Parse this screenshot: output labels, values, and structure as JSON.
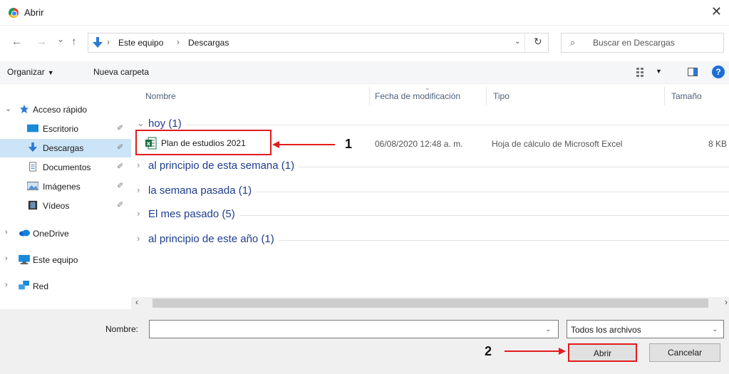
{
  "window": {
    "title": "Abrir",
    "close_glyph": "✕"
  },
  "nav_buttons": {
    "back": "←",
    "forward": "→",
    "recent": "⌄",
    "up": "↑"
  },
  "address": {
    "crumbs": [
      "Este equipo",
      "Descargas"
    ],
    "separator": "›",
    "dropdown": "⌄",
    "refresh": "↻"
  },
  "search": {
    "placeholder": "Buscar en Descargas",
    "icon": "search-icon"
  },
  "toolbar": {
    "organize": "Organizar",
    "new_folder": "Nueva carpeta",
    "help": "?"
  },
  "sidebar": {
    "items": [
      {
        "label": "Acceso rápido",
        "icon": "star-icon",
        "expander": "⌄"
      },
      {
        "label": "Escritorio",
        "icon": "desktop-icon",
        "pin": "📌"
      },
      {
        "label": "Descargas",
        "icon": "download-icon",
        "pin": "📌",
        "selected": true
      },
      {
        "label": "Documentos",
        "icon": "documents-icon",
        "pin": "📌"
      },
      {
        "label": "Imágenes",
        "icon": "pictures-icon",
        "pin": "📌"
      },
      {
        "label": "Vídeos",
        "icon": "videos-icon",
        "pin": "📌"
      },
      {
        "label": "OneDrive",
        "icon": "cloud-icon",
        "expander": "›"
      },
      {
        "label": "Este equipo",
        "icon": "computer-icon",
        "expander": "›"
      },
      {
        "label": "Red",
        "icon": "network-icon",
        "expander": "›"
      }
    ]
  },
  "columns": {
    "name": "Nombre",
    "date": "Fecha de modificación",
    "type": "Tipo",
    "size": "Tamaño"
  },
  "groups": [
    {
      "label": "hoy (1)",
      "chevron": "⌄"
    },
    {
      "label": "al principio de esta semana (1)",
      "chevron": "›"
    },
    {
      "label": "la semana pasada (1)",
      "chevron": "›"
    },
    {
      "label": "El mes pasado (5)",
      "chevron": "›"
    },
    {
      "label": "al principio de este año (1)",
      "chevron": "›"
    }
  ],
  "file": {
    "name": "Plan de estudios 2021",
    "date": "06/08/2020 12:48 a. m.",
    "type": "Hoja de cálculo de Microsoft Excel",
    "size": "8 KB"
  },
  "annotations": {
    "one": "1",
    "two": "2"
  },
  "scroll": {
    "left": "‹",
    "right": "›"
  },
  "bottom": {
    "name_label": "Nombre:",
    "name_value": "",
    "filter": "Todos los archivos",
    "open": "Abrir",
    "cancel": "Cancelar"
  },
  "colors": {
    "annotation_red": "#e11c1c",
    "selected_bg": "#cce4f7",
    "group_text": "#1e3d8f"
  }
}
